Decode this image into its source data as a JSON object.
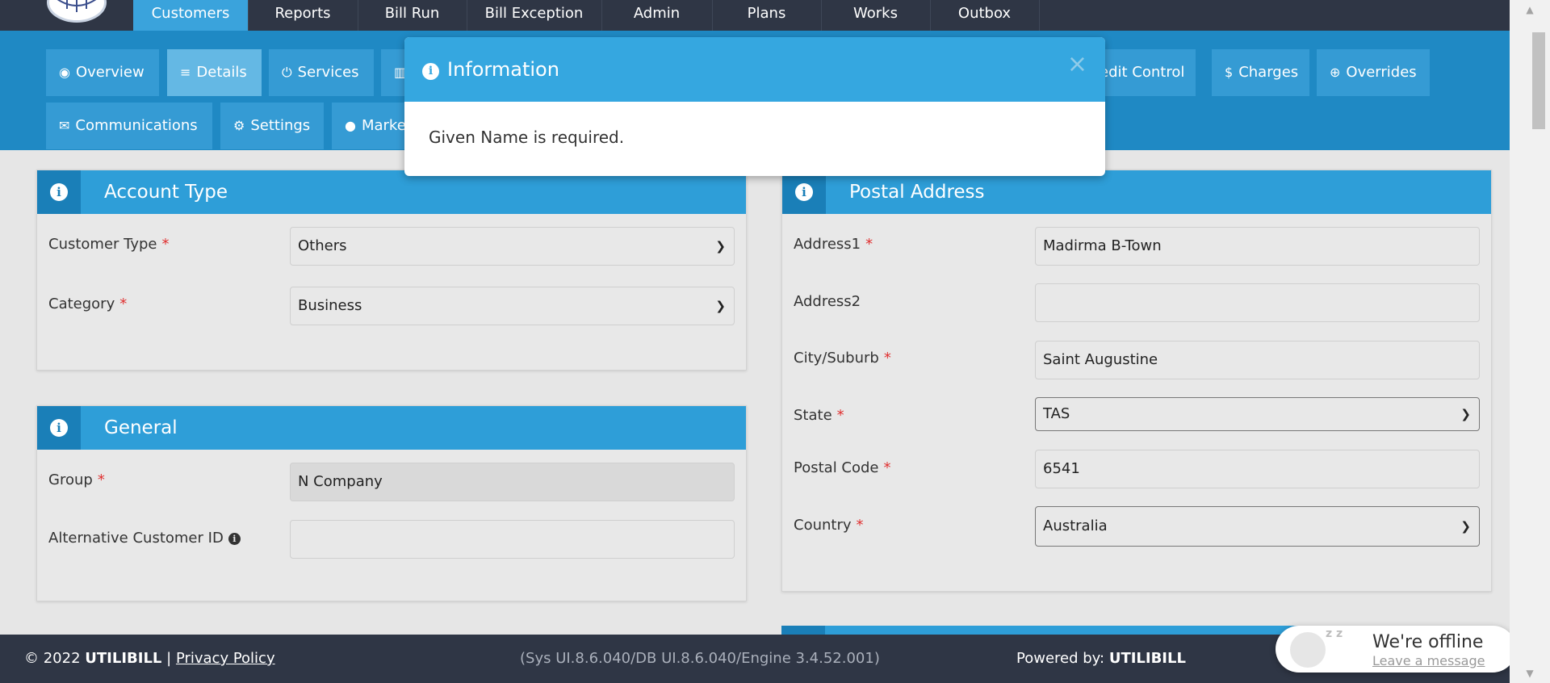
{
  "nav": {
    "items": [
      {
        "label": "Customers",
        "active": true
      },
      {
        "label": "Reports"
      },
      {
        "label": "Bill Run"
      },
      {
        "label": "Bill Exception"
      },
      {
        "label": "Admin"
      },
      {
        "label": "Plans"
      },
      {
        "label": "Works"
      },
      {
        "label": "Outbox"
      }
    ]
  },
  "tabs": {
    "overview": "Overview",
    "details": "Details",
    "services": "Services",
    "credit_control": "edit Control",
    "charges": "Charges",
    "overrides": "Overrides",
    "communications": "Communications",
    "settings": "Settings",
    "marketing": "Marke"
  },
  "account_type": {
    "title": "Account Type",
    "customer_type_label": "Customer Type",
    "customer_type_value": "Others",
    "category_label": "Category",
    "category_value": "Business",
    "required_mark": "*"
  },
  "general": {
    "title": "General",
    "group_label": "Group",
    "group_value": "N Company",
    "alt_id_label": "Alternative Customer ID",
    "alt_id_value": ""
  },
  "postal": {
    "title": "Postal Address",
    "address1_label": "Address1",
    "address1_value": "Madirma B-Town",
    "address2_label": "Address2",
    "address2_value": "",
    "city_label": "City/Suburb",
    "city_value": "Saint Augustine",
    "state_label": "State",
    "state_value": "TAS",
    "postcode_label": "Postal Code",
    "postcode_value": "6541",
    "country_label": "Country",
    "country_value": "Australia"
  },
  "modal": {
    "title": "Information",
    "message": "Given Name is required.",
    "close": "×"
  },
  "footer": {
    "copyright": "© 2022",
    "brand": "UTILIBILL",
    "separator": "|",
    "privacy": "Privacy Policy",
    "version": "(Sys UI.8.6.040/DB UI.8.6.040/Engine 3.4.52.001)",
    "powered_label": "Powered by:",
    "powered_brand": "UTILIBILL"
  },
  "chat": {
    "status": "We're offline",
    "action": "Leave a message",
    "icon_text": "z z"
  },
  "colors": {
    "nav_bg": "#2f3645",
    "accent": "#3aa3dc",
    "tab_band": "#1f89c4",
    "panel_head": "#2e9ed8",
    "required": "#e03030"
  }
}
